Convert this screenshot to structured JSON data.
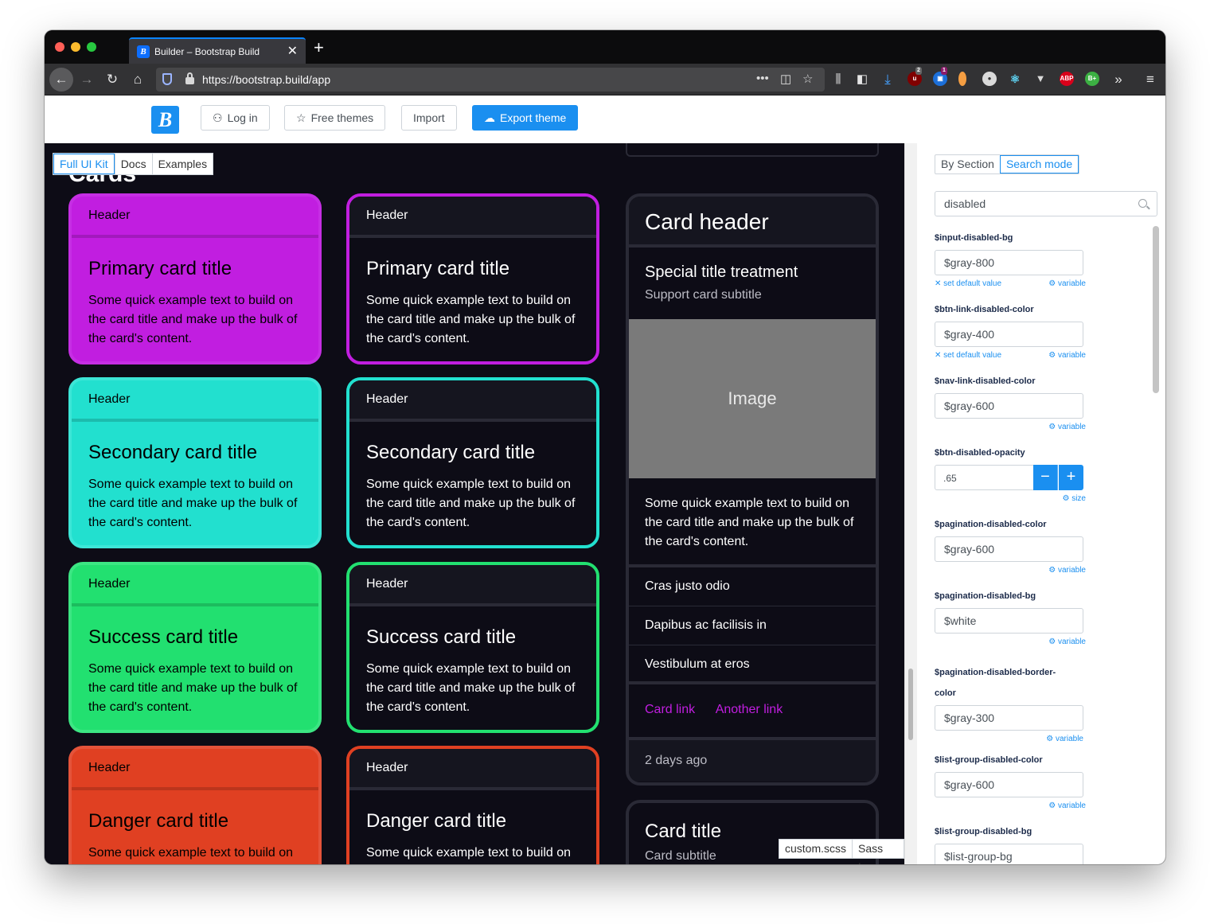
{
  "browser": {
    "tab_title": "Builder – Bootstrap Build",
    "tab_favicon": "B",
    "url": "https://bootstrap.build/app",
    "ext_badge_1": "2",
    "ext_badge_2": "1",
    "ext_abp": "ABP",
    "ext_b": "B+",
    "colors": {
      "accent": "#0a84ff",
      "close": "#ff5f57",
      "minimize": "#febc2e",
      "zoom": "#28c840"
    }
  },
  "app": {
    "logo": "B",
    "login": "Log in",
    "free_themes": "Free themes",
    "import": "Import",
    "export": "Export theme",
    "primary_color": "#1a8ff0"
  },
  "preview": {
    "view_tabs": [
      "Full UI Kit",
      "Docs",
      "Examples"
    ],
    "heading": "Cards",
    "cards": [
      {
        "header": "Header",
        "title": "Primary card title",
        "text": "Some quick example text to build on the card title and make up the bulk of the card's content.",
        "color": "#c11ee0"
      },
      {
        "header": "Header",
        "title": "Secondary card title",
        "text": "Some quick example text to build on the card title and make up the bulk of the card's content.",
        "color": "#22e0cf"
      },
      {
        "header": "Header",
        "title": "Success card title",
        "text": "Some quick example text to build on the card title and make up the bulk of the card's content.",
        "color": "#22e070"
      },
      {
        "header": "Header",
        "title": "Danger card title",
        "text": "Some quick example text to build on the card title and make up the bulk of the card's content.",
        "color": "#e04022"
      }
    ],
    "big_card": {
      "header": "Card header",
      "title": "Special title treatment",
      "subtitle": "Support card subtitle",
      "image": "Image",
      "text": "Some quick example text to build on the card title and make up the bulk of the card's content.",
      "list": [
        "Cras justo odio",
        "Dapibus ac facilisis in",
        "Vestibulum at eros"
      ],
      "link1": "Card link",
      "link2": "Another link",
      "footer": "2 days ago"
    },
    "small_card": {
      "title": "Card title",
      "subtitle": "Card subtitle"
    },
    "bottom_tabs": [
      "custom.scss",
      "Sass Log"
    ]
  },
  "panel": {
    "mode_tabs": [
      "By Section",
      "Search mode"
    ],
    "search_value": "disabled",
    "set_default": "set default value",
    "vars": [
      {
        "name": "$input-disabled-bg",
        "value": "$gray-800",
        "action": "variable",
        "default": true
      },
      {
        "name": "$btn-link-disabled-color",
        "value": "$gray-400",
        "action": "variable",
        "default": true
      },
      {
        "name": "$nav-link-disabled-color",
        "value": "$gray-600",
        "action": "variable",
        "default": false
      },
      {
        "name": "$btn-disabled-opacity",
        "value": ".65",
        "action": "size",
        "default": false
      },
      {
        "name": "$pagination-disabled-color",
        "value": "$gray-600",
        "action": "variable",
        "default": false
      },
      {
        "name": "$pagination-disabled-bg",
        "value": "$white",
        "action": "variable",
        "default": false
      },
      {
        "name": "$pagination-disabled-border-color",
        "value": "$gray-300",
        "action": "variable",
        "default": false
      },
      {
        "name": "$list-group-disabled-color",
        "value": "$gray-600",
        "action": "variable",
        "default": false
      },
      {
        "name": "$list-group-disabled-bg",
        "value": "$list-group-bg",
        "action": "variable",
        "default": false
      }
    ]
  }
}
